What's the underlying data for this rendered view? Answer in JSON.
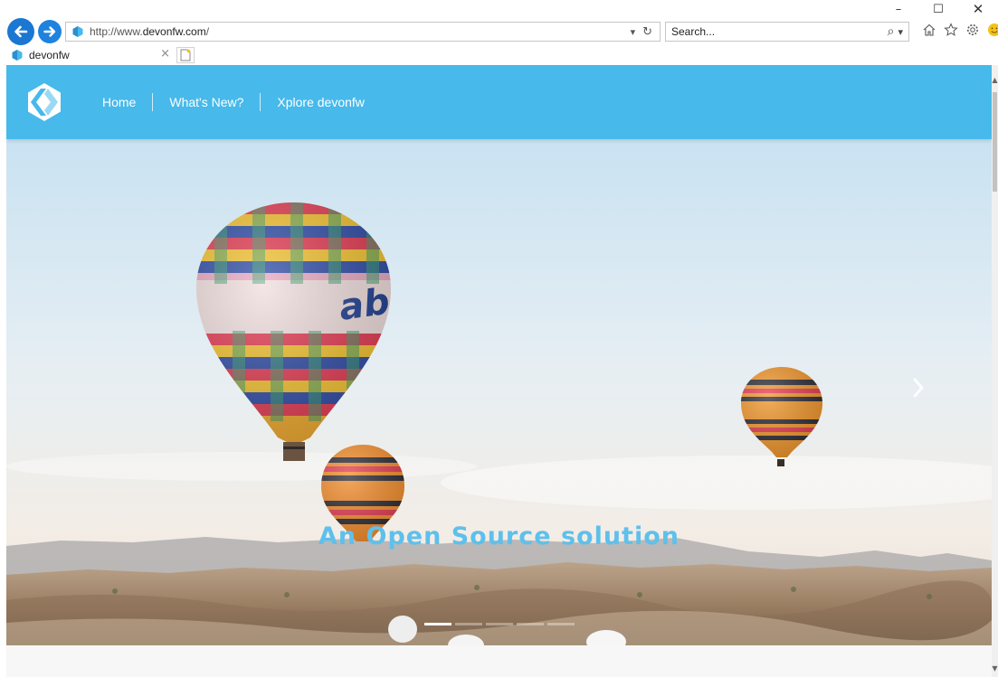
{
  "browser": {
    "address": {
      "url_prefix": "http://www.",
      "url_domain": "devonfw.com",
      "url_suffix": "/",
      "dropdown_glyph": "▾",
      "refresh_glyph": "↻"
    },
    "search": {
      "placeholder": "Search...",
      "search_glyph": "⌕",
      "dropdown_glyph": "▾"
    },
    "window_controls": {
      "minimize": "–",
      "maximize": "☐",
      "close": "✕"
    },
    "toolbar_icons": [
      "home-icon",
      "favorites-star-icon",
      "settings-gear-icon",
      "feedback-smiley-icon"
    ],
    "tab": {
      "title": "devonfw",
      "close_glyph": "×"
    }
  },
  "site": {
    "brand_color": "#47b9ea",
    "nav": [
      {
        "label": "Home"
      },
      {
        "label": "What's New?"
      },
      {
        "label": "Xplore devonfw"
      }
    ],
    "hero": {
      "caption": "An Open Source solution",
      "caption_color": "#5ec0ec",
      "slide_count": 5,
      "active_slide": 1
    }
  }
}
